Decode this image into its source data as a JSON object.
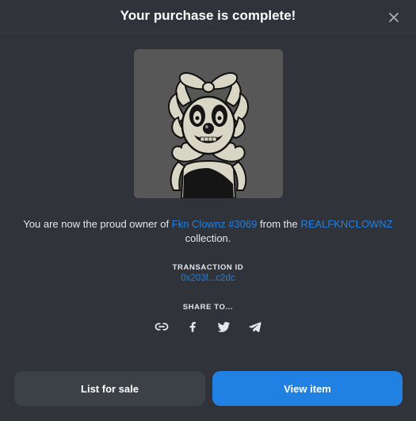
{
  "modal": {
    "title": "Your purchase is complete!",
    "close_icon": "close-icon"
  },
  "nft": {
    "image_icon": "clown-nft-image"
  },
  "ownership": {
    "prefix": "You are now the proud owner of ",
    "item_name": "Fkn Clownz #3069",
    "middle": " from the ",
    "collection_name": "REALFKNCLOWNZ",
    "suffix": "collection."
  },
  "transaction": {
    "label": "TRANSACTION ID",
    "id": "0x203f...c2dc"
  },
  "share": {
    "label": "SHARE TO...",
    "icons": [
      "link-icon",
      "facebook-icon",
      "twitter-icon",
      "telegram-icon"
    ]
  },
  "actions": {
    "list_label": "List for sale",
    "view_label": "View item"
  },
  "colors": {
    "accent": "#2081e2",
    "modal_bg": "#303339",
    "secondary_button": "#3c4047"
  }
}
